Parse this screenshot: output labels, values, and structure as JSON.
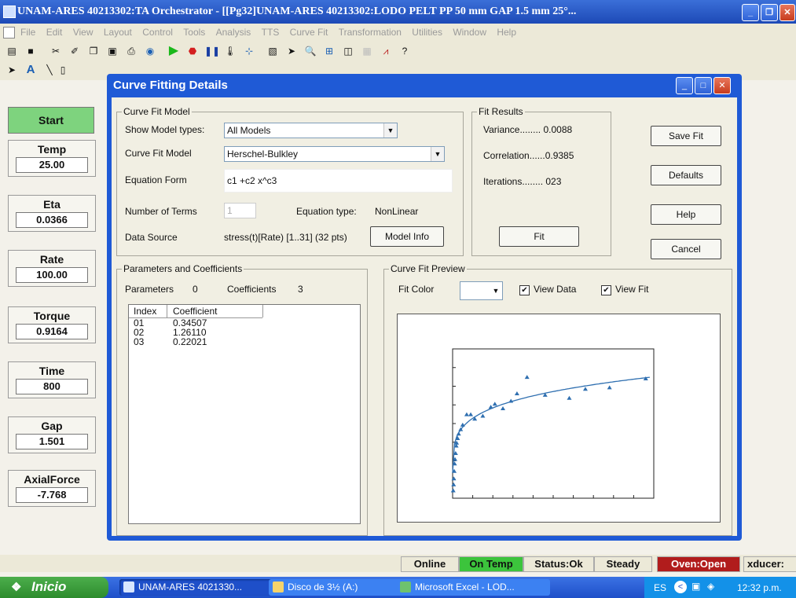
{
  "app": {
    "title": "UNAM-ARES 40213302:TA Orchestrator - [[Pg32]UNAM-ARES 40213302:LODO PELT PP 50 mm GAP 1.5 mm 25°...",
    "menu": [
      "File",
      "Edit",
      "View",
      "Layout",
      "Control",
      "Tools",
      "Analysis",
      "TTS",
      "Curve Fit",
      "Transformation",
      "Utilities",
      "Window",
      "Help"
    ]
  },
  "left_panel": {
    "start_label": "Start",
    "meters": [
      {
        "label": "Temp",
        "value": "25.00"
      },
      {
        "label": "Eta",
        "value": "0.0366"
      },
      {
        "label": "Rate",
        "value": "100.00"
      },
      {
        "label": "Torque",
        "value": "0.9164"
      },
      {
        "label": "Time",
        "value": "800"
      },
      {
        "label": "Gap",
        "value": "1.501"
      },
      {
        "label": "AxialForce",
        "value": "-7.768"
      }
    ]
  },
  "dialog": {
    "title": "Curve Fitting Details",
    "model": {
      "group_title": "Curve Fit Model",
      "show_types_label": "Show Model types:",
      "show_types_value": "All Models",
      "model_label": "Curve Fit Model",
      "model_value": "Herschel-Bulkley",
      "equation_label": "Equation Form",
      "equation_value": "c1 +c2 x^c3",
      "terms_label": "Number of Terms",
      "terms_value": "1",
      "eqtype_label": "Equation type:",
      "eqtype_value": "NonLinear",
      "source_label": "Data Source",
      "source_value": "stress(t)[Rate) [1..31] (32 pts)",
      "model_info_button": "Model Info"
    },
    "results": {
      "group_title": "Fit Results",
      "variance": "Variance........ 0.0088",
      "correlation": "Correlation......0.9385",
      "iterations": "Iterations........ 023",
      "fit_button": "Fit"
    },
    "buttons": {
      "save": "Save Fit",
      "defaults": "Defaults",
      "help": "Help",
      "cancel": "Cancel"
    },
    "params": {
      "group_title": "Parameters and Coefficients",
      "parameters_label": "Parameters",
      "parameters_value": "0",
      "coefficients_label": "Coefficients",
      "coefficients_value": "3",
      "columns": [
        "Index",
        "Coefficient"
      ],
      "rows": [
        {
          "index": "01",
          "coef": "0.34507"
        },
        {
          "index": "02",
          "coef": "1.26110"
        },
        {
          "index": "03",
          "coef": "0.22021"
        }
      ]
    },
    "preview": {
      "group_title": "Curve Fit Preview",
      "fit_color_label": "Fit Color",
      "view_data_label": "View Data",
      "view_data_checked": true,
      "view_fit_label": "View Fit",
      "view_fit_checked": true,
      "curve_color": "#2f6fb0"
    }
  },
  "chart_data": {
    "type": "scatter",
    "xlim": [
      0,
      10
    ],
    "ylim": [
      0,
      10
    ],
    "series": [
      {
        "points": [
          [
            0.03,
            0.5
          ],
          [
            0.05,
            0.9
          ],
          [
            0.06,
            1.3
          ],
          [
            0.08,
            1.8
          ],
          [
            0.1,
            2.3
          ],
          [
            0.12,
            2.6
          ],
          [
            0.15,
            3.0
          ],
          [
            0.18,
            3.5
          ],
          [
            0.2,
            3.7
          ],
          [
            0.25,
            4.0
          ],
          [
            0.3,
            4.3
          ],
          [
            0.4,
            4.6
          ],
          [
            0.5,
            4.9
          ],
          [
            0.7,
            5.6
          ],
          [
            0.9,
            5.6
          ],
          [
            1.1,
            5.3
          ],
          [
            1.5,
            5.5
          ],
          [
            1.9,
            6.1
          ],
          [
            2.1,
            6.3
          ],
          [
            2.5,
            6.0
          ],
          [
            2.9,
            6.5
          ],
          [
            3.2,
            7.0
          ],
          [
            3.7,
            8.1
          ],
          [
            4.6,
            6.9
          ],
          [
            5.8,
            6.7
          ],
          [
            6.6,
            7.3
          ],
          [
            7.8,
            7.4
          ],
          [
            9.6,
            8.0
          ]
        ],
        "curve": "c1 + c2*x^c3"
      }
    ]
  },
  "status_bar": [
    "Online",
    "On Temp",
    "Status:Ok",
    "Steady",
    "Oven:Open",
    "xducer:"
  ],
  "taskbar": {
    "start": "Inicio",
    "tasks": [
      "UNAM-ARES 4021330...",
      "Disco de 3½ (A:)",
      "Microsoft Excel - LOD..."
    ],
    "tray_lang": "ES",
    "clock": "12:32 p.m."
  }
}
